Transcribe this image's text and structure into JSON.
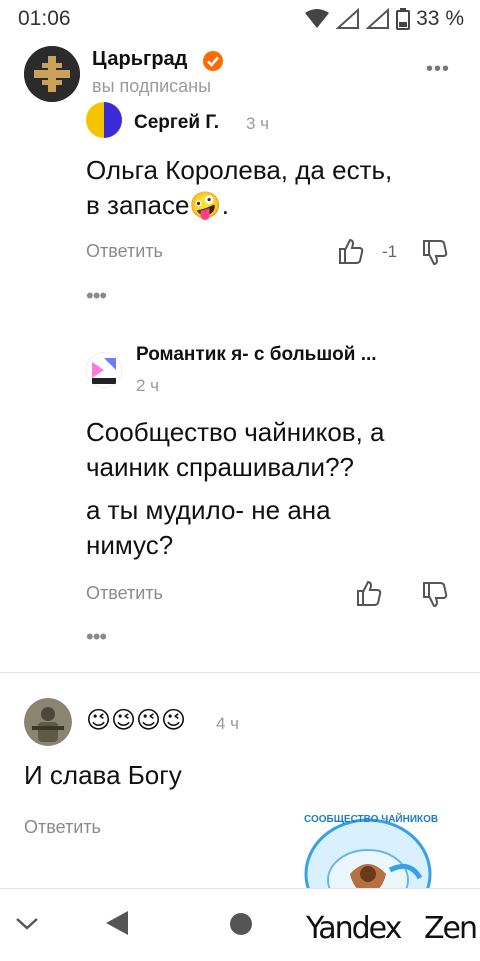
{
  "status_bar": {
    "time": "01:06",
    "battery_text": "33 %"
  },
  "header": {
    "channel_name": "Царьград",
    "subscription_status": "вы подписаны",
    "more_label": "•••"
  },
  "comments": [
    {
      "author": "Сергей Г.",
      "time_ago": "3 ч",
      "text_lines": [
        "Ольга Королева, да есть,",
        "в запасе🤪."
      ],
      "reply_label": "Ответить",
      "rating": "-1",
      "more_label": "•••"
    },
    {
      "author": "Романтик я- с большой ...",
      "time_ago": "2 ч",
      "text_lines": [
        "Сообщество чайников, а",
        "чаиник спрашивали??",
        "а ты мудило- не ана",
        "нимус?"
      ],
      "reply_label": "Ответить",
      "more_label": "•••"
    },
    {
      "author": "😉😉😉😉",
      "time_ago": "4 ч",
      "text_lines": [
        "И слава Богу"
      ],
      "reply_label": "Ответить"
    }
  ],
  "bottom_nav": {
    "brand_left": "Yandex",
    "brand_right": "Zen"
  },
  "watermark": {
    "text": "СООБЩЕСТВО ЧАЙНИКОВ"
  },
  "colors": {
    "accent_orange": "#ff6a00",
    "text_gray": "#8a8a8a",
    "divider": "#e2e2e2"
  }
}
